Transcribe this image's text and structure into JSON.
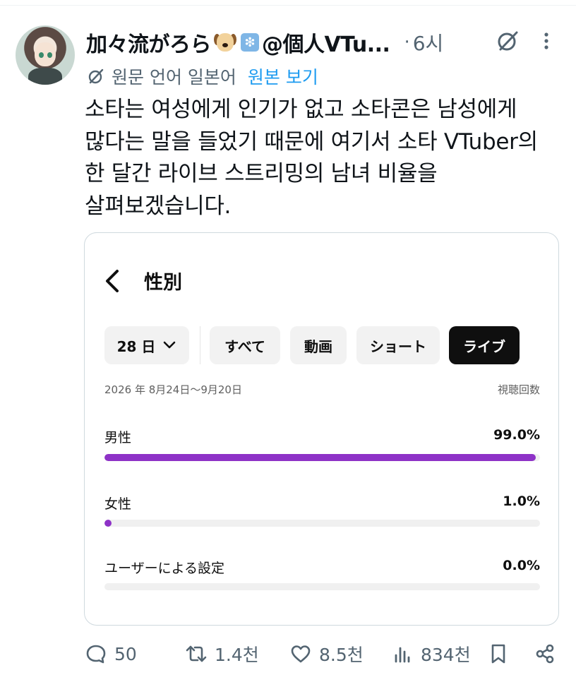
{
  "post": {
    "display_name": "加々流がろら",
    "handle": "@個人VTu...",
    "separator": "·",
    "time": "6시",
    "avatar_icon": "avatar",
    "badge_icons": [
      "dog-face-emoji",
      "sparkle-emoji"
    ],
    "translate": {
      "text": "원문 언어 일본어",
      "link": "원본 보기"
    },
    "text_lines": [
      "소타는 여성에게 인기가 없고 소타콘은 남성에게",
      "많다는 말을 들었기 때문에 여기서 소타 VTuber의",
      "한 달간 라이브 스트리밍의 남녀 비율을",
      "살펴보겠습니다."
    ]
  },
  "embedded_screenshot": {
    "title": "性別",
    "filters": {
      "period": "28 日",
      "chips": [
        "すべて",
        "動画",
        "ショート",
        "ライブ"
      ],
      "active_chip": "ライブ"
    },
    "date_range": "2026 年 8月24日〜9月20日",
    "metric": "視聴回数",
    "rows": [
      {
        "label": "男性",
        "value": "99.0%",
        "fraction": 0.99
      },
      {
        "label": "女性",
        "value": "1.0%",
        "fraction": 0.01
      },
      {
        "label": "ユーザーによる設定",
        "value": "0.0%",
        "fraction": 0.0
      }
    ],
    "accent_color": "#8e32c7"
  },
  "actions": {
    "replies": "50",
    "reposts": "1.4천",
    "likes": "8.5천",
    "views": "834천",
    "icons": [
      "reply-icon",
      "repost-icon",
      "like-icon",
      "views-icon",
      "bookmark-icon",
      "share-icon"
    ]
  }
}
